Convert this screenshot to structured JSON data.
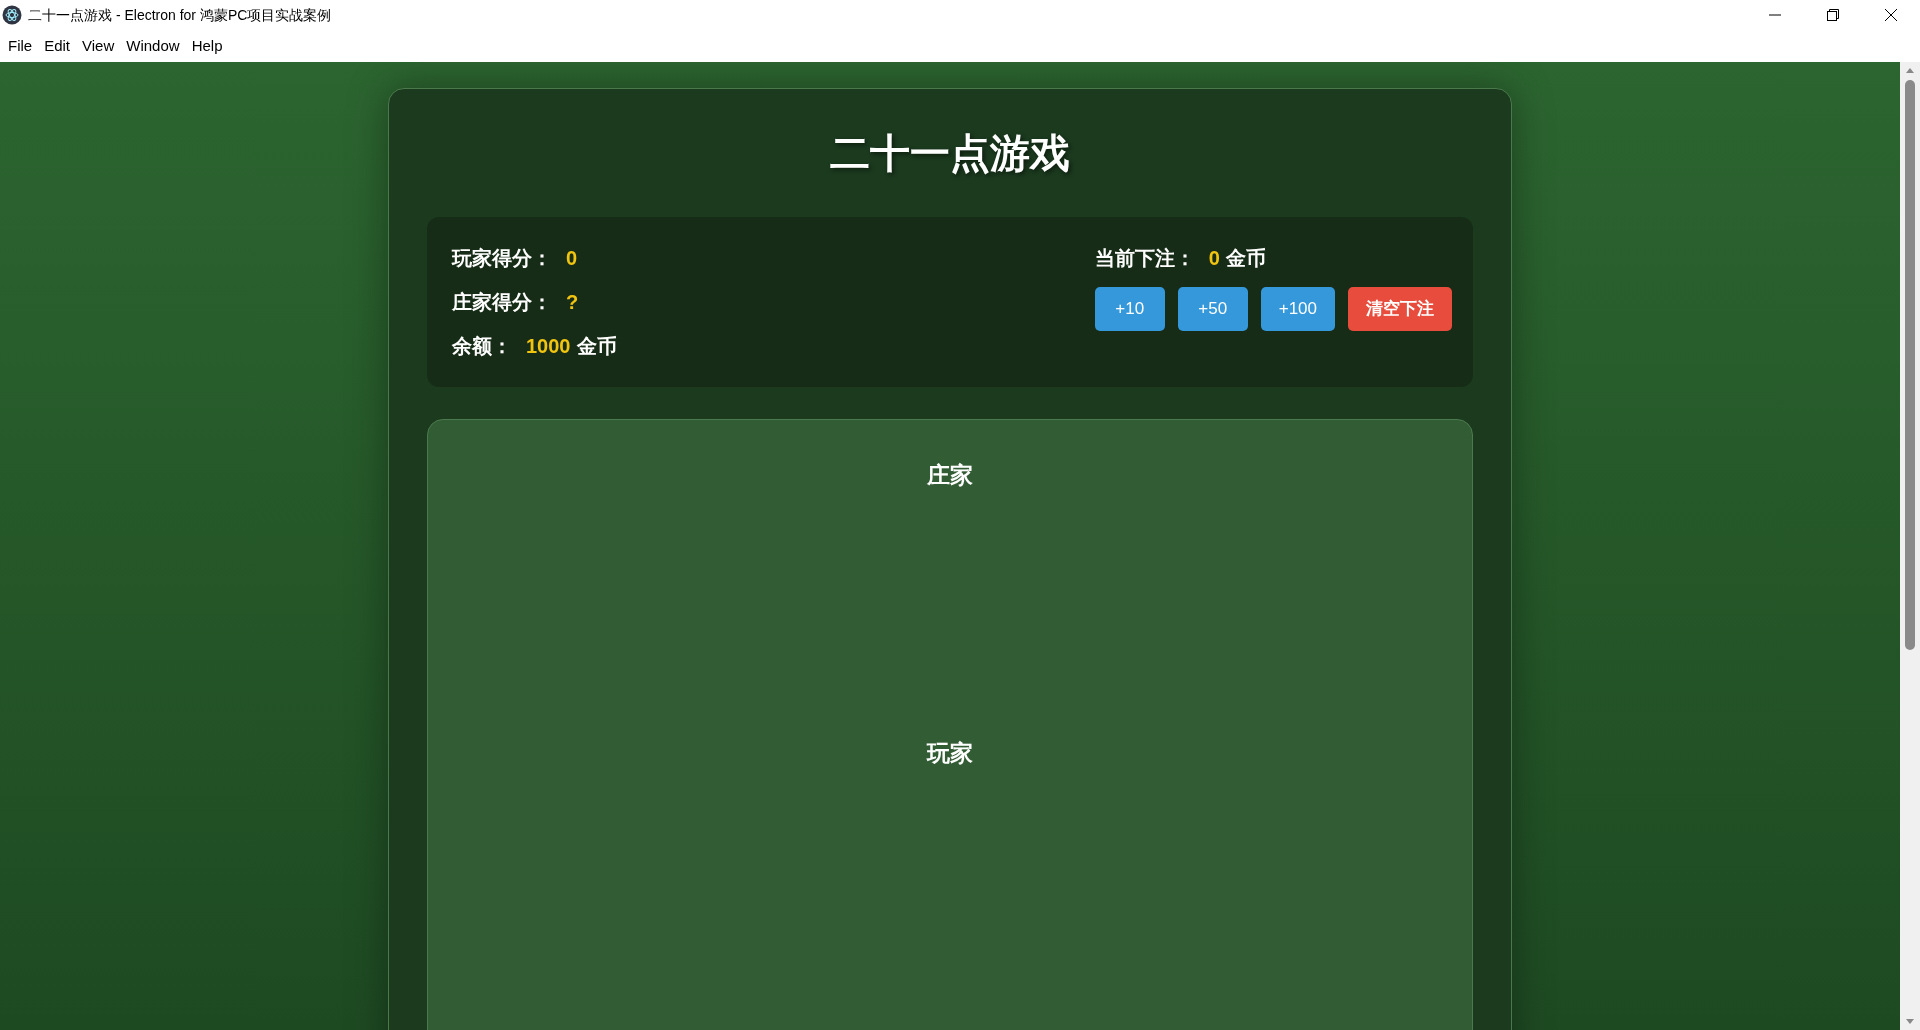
{
  "window": {
    "title": "二十一点游戏 - Electron for 鸿蒙PC项目实战案例"
  },
  "menu": [
    "File",
    "Edit",
    "View",
    "Window",
    "Help"
  ],
  "game": {
    "title": "二十一点游戏",
    "stats": [
      {
        "label": "玩家得分：",
        "value": "0"
      },
      {
        "label": "庄家得分：",
        "value": "?"
      },
      {
        "label": "余额：",
        "value": "1000",
        "unit": "金币"
      }
    ],
    "bet": {
      "label": "当前下注：",
      "value": "0",
      "unit": "金币"
    },
    "bet_buttons": [
      {
        "label": "+10",
        "kind": "add"
      },
      {
        "label": "+50",
        "kind": "add"
      },
      {
        "label": "+100",
        "kind": "add"
      },
      {
        "label": "清空下注",
        "kind": "clear"
      }
    ],
    "areas": [
      {
        "title": "庄家"
      },
      {
        "title": "玩家"
      }
    ]
  }
}
